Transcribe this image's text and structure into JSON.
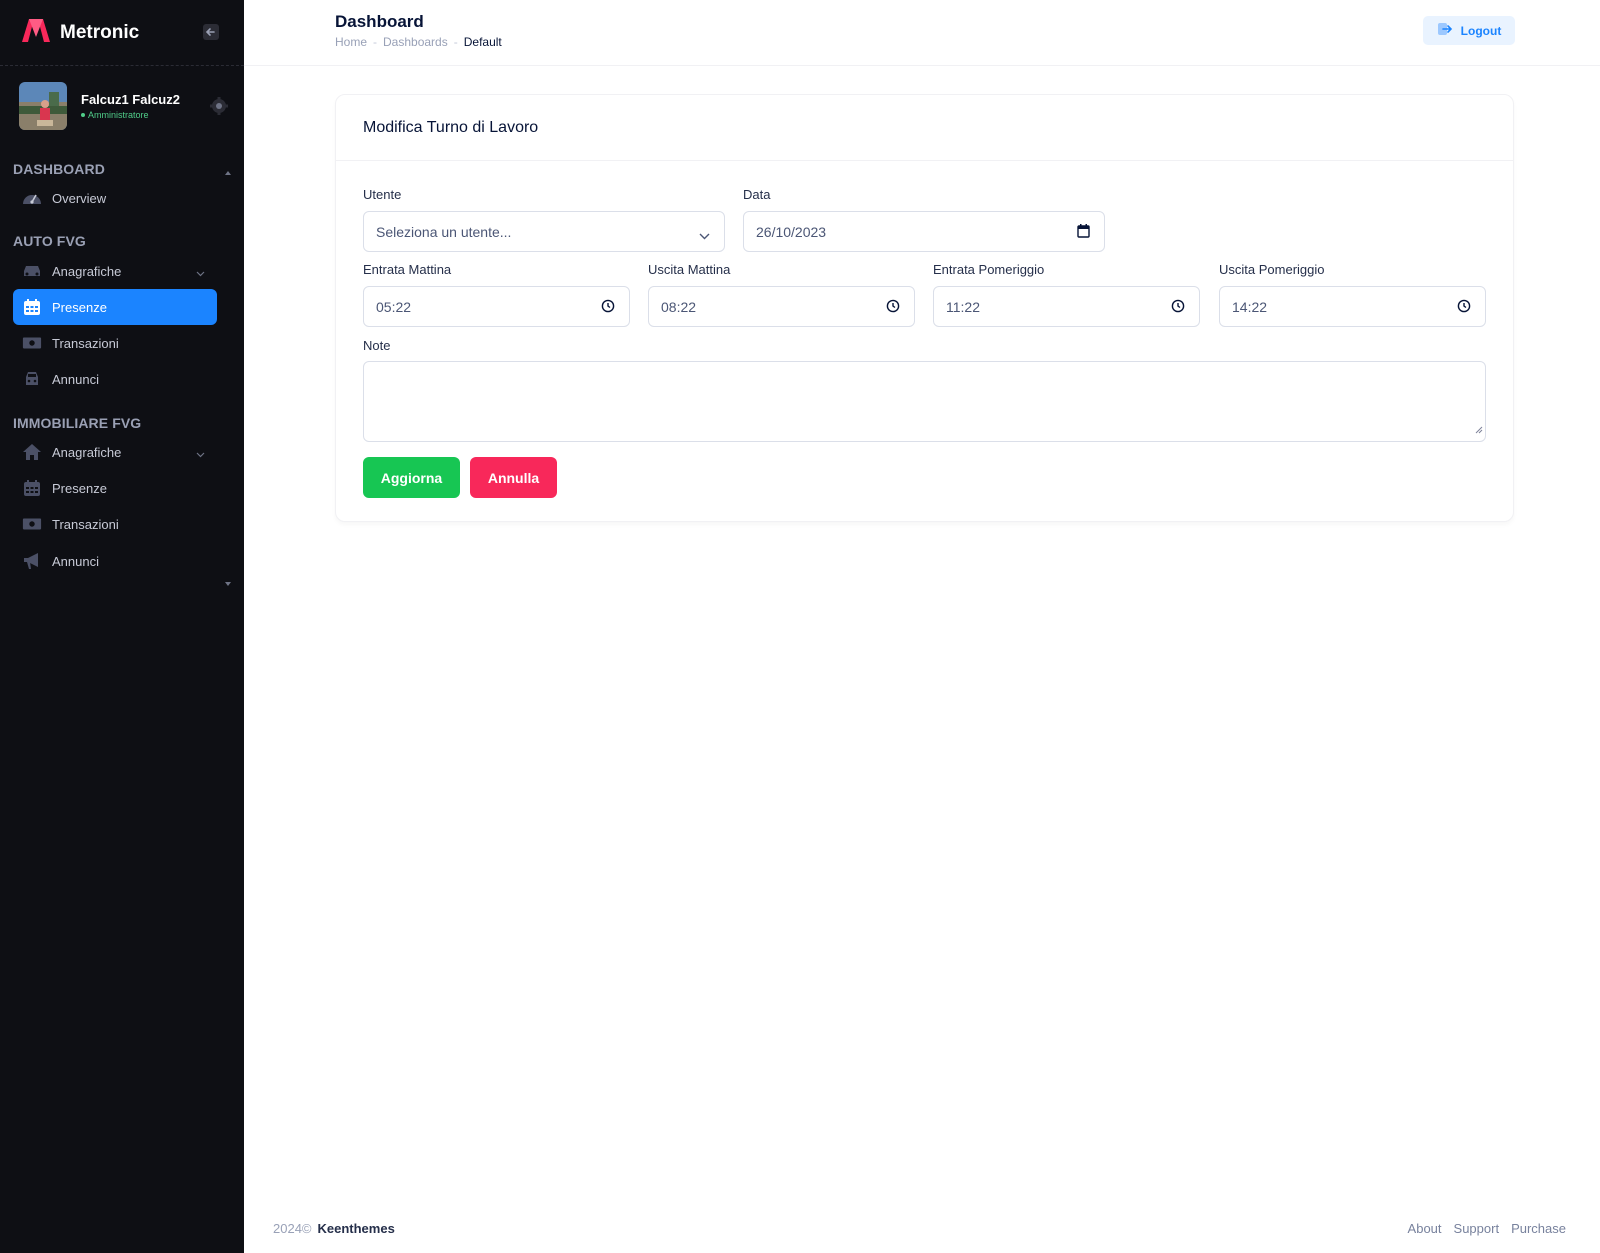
{
  "brand": {
    "name": "Metronic",
    "accent": "#f8285a"
  },
  "user": {
    "name": "Falcuz1 Falcuz2",
    "role": "Amministratore"
  },
  "sidebar": {
    "sections": [
      {
        "title": "DASHBOARD",
        "items": [
          {
            "label": "Overview",
            "icon": "speedometer-icon"
          }
        ]
      },
      {
        "title": "AUTO FVG",
        "items": [
          {
            "label": "Anagrafiche",
            "icon": "car-icon"
          },
          {
            "label": "Presenze",
            "icon": "calendar-icon",
            "active": true
          },
          {
            "label": "Transazioni",
            "icon": "money-icon"
          },
          {
            "label": "Annunci",
            "icon": "car-front-icon"
          }
        ]
      },
      {
        "title": "IMMOBILIARE FVG",
        "items": [
          {
            "label": "Anagrafiche",
            "icon": "home-icon"
          },
          {
            "label": "Presenze",
            "icon": "calendar-icon"
          },
          {
            "label": "Transazioni",
            "icon": "money-icon"
          },
          {
            "label": "Annunci",
            "icon": "megaphone-icon"
          }
        ]
      }
    ]
  },
  "header": {
    "title": "Dashboard",
    "breadcrumb": [
      "Home",
      "Dashboards",
      "Default"
    ],
    "logout_label": "Logout"
  },
  "form": {
    "title": "Modifica Turno di Lavoro",
    "utente": {
      "label": "Utente",
      "placeholder": "Seleziona un utente..."
    },
    "data": {
      "label": "Data",
      "value": "26/10/2023"
    },
    "entrata_mattina": {
      "label": "Entrata Mattina",
      "value": "05:22"
    },
    "uscita_mattina": {
      "label": "Uscita Mattina",
      "value": "08:22"
    },
    "entrata_pomeriggio": {
      "label": "Entrata Pomeriggio",
      "value": "11:22"
    },
    "uscita_pomeriggio": {
      "label": "Uscita Pomeriggio",
      "value": "14:22"
    },
    "note": {
      "label": "Note",
      "value": ""
    },
    "submit_label": "Aggiorna",
    "cancel_label": "Annulla"
  },
  "footer": {
    "year": "2024©",
    "company": "Keenthemes",
    "links": [
      "About",
      "Support",
      "Purchase"
    ]
  },
  "colors": {
    "sidebar_bg": "#0e0f14",
    "primary": "#1b84ff",
    "success": "#17c653",
    "danger": "#f8285a"
  }
}
